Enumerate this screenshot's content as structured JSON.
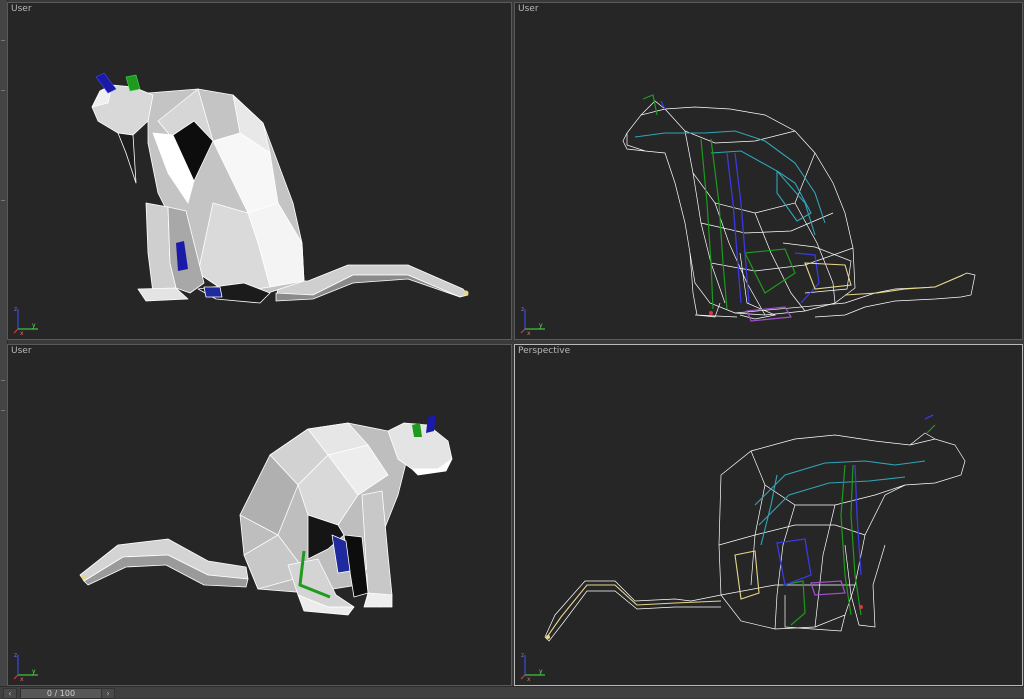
{
  "viewports": [
    {
      "label": "User",
      "view": "shaded"
    },
    {
      "label": "User",
      "view": "wireframe"
    },
    {
      "label": "User",
      "view": "shaded"
    },
    {
      "label": "Perspective",
      "view": "wireframe",
      "active": true
    }
  ],
  "timeline": {
    "frame_text": "0 / 100",
    "prev_icon": "chevron-left-icon",
    "next_icon": "chevron-right-icon"
  },
  "colors": {
    "viewport_bg": "#262626",
    "mesh_light": "#f2f2f2",
    "wire": "#ffffff",
    "bone_blue": "#1a1aa8",
    "bone_green": "#1e9a1e",
    "bone_cyan": "#2fa6b8",
    "tail_bone": "#e8d68a",
    "axis_x": "#d63a3a",
    "axis_y": "#3fbf3f",
    "axis_z": "#3a4ad6"
  }
}
